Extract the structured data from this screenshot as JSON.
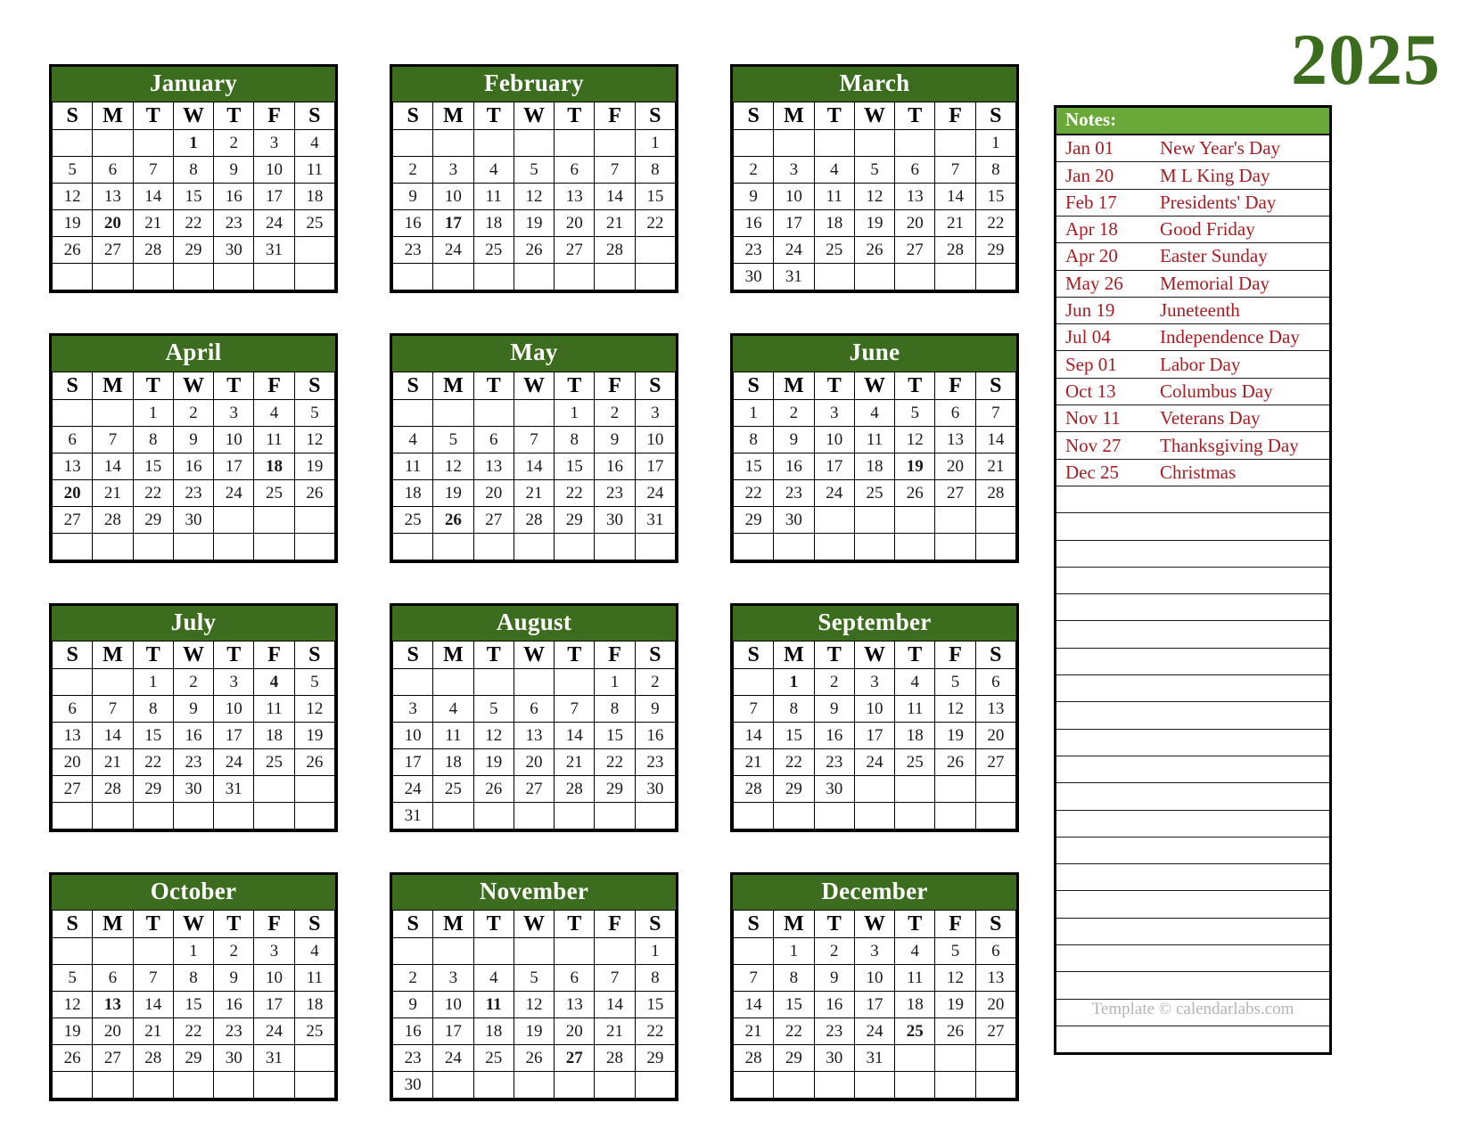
{
  "year_title": "2025",
  "footer": "Template © calendarlabs.com",
  "colors": {
    "header_green": "#3c6c1e",
    "notes_header_green": "#6aa83a",
    "weekend_green": "#2fc63c",
    "holiday_red": "#a81c22",
    "year_green": "#3c6c1e",
    "footer_gray": "#b4b4b4"
  },
  "weekday_headers": [
    "S",
    "M",
    "T",
    "W",
    "T",
    "F",
    "S"
  ],
  "notes": {
    "header": "Notes:",
    "entries": [
      {
        "date": "Jan 01",
        "name": "New Year's Day"
      },
      {
        "date": "Jan 20",
        "name": "M L King Day"
      },
      {
        "date": "Feb 17",
        "name": "Presidents' Day"
      },
      {
        "date": "Apr 18",
        "name": "Good Friday"
      },
      {
        "date": "Apr 20",
        "name": "Easter Sunday"
      },
      {
        "date": "May 26",
        "name": "Memorial Day"
      },
      {
        "date": "Jun 19",
        "name": "Juneteenth"
      },
      {
        "date": "Jul 04",
        "name": "Independence Day"
      },
      {
        "date": "Sep 01",
        "name": "Labor Day"
      },
      {
        "date": "Oct 13",
        "name": "Columbus Day"
      },
      {
        "date": "Nov 11",
        "name": "Veterans Day"
      },
      {
        "date": "Nov 27",
        "name": "Thanksgiving Day"
      },
      {
        "date": "Dec 25",
        "name": "Christmas"
      }
    ],
    "blank_line_count": 21
  },
  "months": [
    {
      "name": "January",
      "first_weekday": 3,
      "days": 31,
      "holidays": [
        1,
        20
      ],
      "weeks": 6
    },
    {
      "name": "February",
      "first_weekday": 6,
      "days": 28,
      "holidays": [
        17
      ],
      "weeks": 6
    },
    {
      "name": "March",
      "first_weekday": 6,
      "days": 31,
      "holidays": [],
      "weeks": 6
    },
    {
      "name": "April",
      "first_weekday": 2,
      "days": 30,
      "holidays": [
        18,
        20
      ],
      "weeks": 6
    },
    {
      "name": "May",
      "first_weekday": 4,
      "days": 31,
      "holidays": [
        26
      ],
      "weeks": 6
    },
    {
      "name": "June",
      "first_weekday": 0,
      "days": 30,
      "holidays": [
        19
      ],
      "weeks": 6
    },
    {
      "name": "July",
      "first_weekday": 2,
      "days": 31,
      "holidays": [
        4
      ],
      "weeks": 6
    },
    {
      "name": "August",
      "first_weekday": 5,
      "days": 31,
      "holidays": [],
      "weeks": 6
    },
    {
      "name": "September",
      "first_weekday": 1,
      "days": 30,
      "holidays": [
        1
      ],
      "weeks": 6
    },
    {
      "name": "October",
      "first_weekday": 3,
      "days": 31,
      "holidays": [
        13
      ],
      "weeks": 6
    },
    {
      "name": "November",
      "first_weekday": 6,
      "days": 30,
      "holidays": [
        11,
        27
      ],
      "weeks": 6
    },
    {
      "name": "December",
      "first_weekday": 1,
      "days": 31,
      "holidays": [
        25
      ],
      "weeks": 6
    }
  ]
}
